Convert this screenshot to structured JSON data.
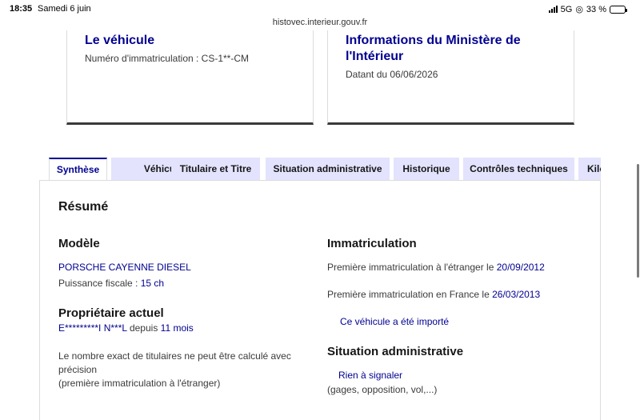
{
  "status_bar": {
    "time": "18:35",
    "date": "Samedi 6 juin",
    "network": "5G",
    "battery": "33 %",
    "battery_level": 0.33
  },
  "browser": {
    "url": "histovec.interieur.gouv.fr"
  },
  "cards": {
    "vehicle": {
      "title": "Le véhicule",
      "registration_label": "Numéro d'immatriculation : CS-1**-CM"
    },
    "ministry": {
      "title_line1": "Informations du Ministère de",
      "title_line2": "l'Intérieur",
      "date_label": "Datant du 06/06/2026"
    }
  },
  "tabs": [
    {
      "label": "Synthèse",
      "active": true
    },
    {
      "label": "Véhicule",
      "active": false
    },
    {
      "label": "Titulaire et Titre",
      "active": false
    },
    {
      "label": "Situation administrative",
      "active": false
    },
    {
      "label": "Historique",
      "active": false
    },
    {
      "label": "Contrôles techniques",
      "active": false
    },
    {
      "label": "Kilo",
      "active": false
    }
  ],
  "summary": {
    "title": "Résumé",
    "model": {
      "heading": "Modèle",
      "name": "PORSCHE CAYENNE DIESEL",
      "fiscal_power_label": "Puissance fiscale :",
      "fiscal_power_value": "15 ch"
    },
    "owner": {
      "heading": "Propriétaire actuel",
      "name": "E*********I N***L",
      "since_label": "depuis",
      "since_value": "11 mois",
      "note_line1": "Le nombre exact de titulaires ne peut être calculé avec",
      "note_line2": "précision",
      "note_line3": "(première immatriculation à l'étranger)"
    },
    "registration": {
      "heading": "Immatriculation",
      "first_abroad_label": "Première immatriculation à l'étranger le",
      "first_abroad_date": "20/09/2012",
      "first_france_label": "Première immatriculation en France le",
      "first_france_date": "26/03/2013",
      "imported_label": "Ce véhicule a été importé"
    },
    "admin_status": {
      "heading": "Situation administrative",
      "status": "Rien à signaler",
      "details": "(gages, opposition, vol,...)"
    }
  }
}
